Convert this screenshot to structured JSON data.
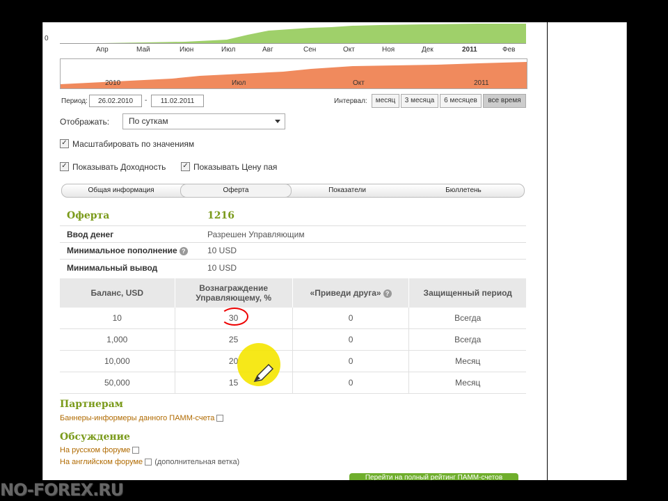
{
  "chart": {
    "y_zero": "0",
    "months_top": [
      "Апр",
      "Май",
      "Июн",
      "Июл",
      "Авг",
      "Сен",
      "Окт",
      "Ноя",
      "Дек",
      "2011",
      "Фев"
    ],
    "nav_labels": [
      "2010",
      "Июл",
      "Окт",
      "2011"
    ]
  },
  "period": {
    "label": "Период:",
    "from": "26.02.2010",
    "sep": "-",
    "to": "11.02.2011"
  },
  "interval": {
    "label": "Интервал:",
    "buttons": [
      "месяц",
      "3 месяца",
      "6 месяцев",
      "все время"
    ]
  },
  "display": {
    "label": "Отображать:",
    "value": "По суткам"
  },
  "checks": {
    "scale": "Масштабировать по значениям",
    "yield": "Показывать Доходность",
    "price": "Показывать Цену пая"
  },
  "tabs": [
    "Общая информация",
    "Оферта",
    "Показатели",
    "Бюллетень"
  ],
  "offer": {
    "title": "Оферта",
    "number": "1216",
    "rows": [
      {
        "k": "Ввод денег",
        "v": "Разрешен Управляющим"
      },
      {
        "k": "Минимальное пополнение",
        "v": "10 USD"
      },
      {
        "k": "Минимальный вывод",
        "v": "10 USD"
      }
    ]
  },
  "table": {
    "headers": [
      "Баланс, USD",
      "Вознаграждение Управляющему, %",
      "«Приведи друга»",
      "Защищенный период"
    ],
    "rows": [
      [
        "10",
        "30",
        "0",
        "Всегда"
      ],
      [
        "1,000",
        "25",
        "0",
        "Всегда"
      ],
      [
        "10,000",
        "20",
        "0",
        "Месяц"
      ],
      [
        "50,000",
        "15",
        "0",
        "Месяц"
      ]
    ]
  },
  "partners": {
    "title": "Партнерам",
    "link": "Баннеры-информеры данного ПАММ-счета"
  },
  "discussion": {
    "title": "Обсуждение",
    "ru": "На русском форуме",
    "en": "На английском форуме",
    "en_note": "(дополнительная ветка)"
  },
  "rating_button": "Перейти на полный рейтинг ПАММ-счетов",
  "watermark": "NO-FOREX.RU",
  "colors": {
    "green": "#9fd06a",
    "orange": "#f08a5d",
    "accent": "#7a9a1a",
    "link": "#b06a00"
  }
}
